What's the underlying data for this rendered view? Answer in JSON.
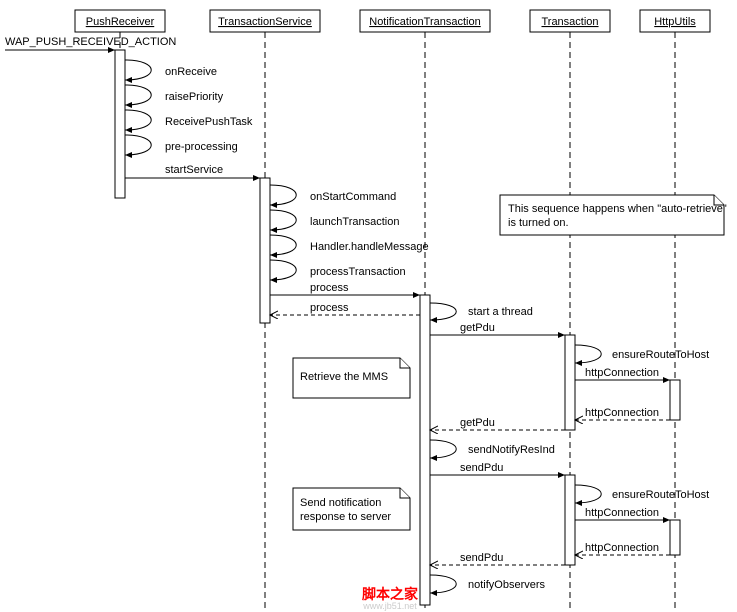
{
  "chart_data": {
    "type": "sequence-diagram",
    "lifelines": [
      "PushReceiver",
      "TransactionService",
      "NotificationTransaction",
      "Transaction",
      "HttpUtils"
    ],
    "trigger": "WAP_PUSH_RECEIVED_ACTION",
    "messages": [
      {
        "from": "PushReceiver",
        "to": "PushReceiver",
        "label": "onReceive",
        "type": "self"
      },
      {
        "from": "PushReceiver",
        "to": "PushReceiver",
        "label": "raisePriority",
        "type": "self"
      },
      {
        "from": "PushReceiver",
        "to": "PushReceiver",
        "label": "ReceivePushTask",
        "type": "self"
      },
      {
        "from": "PushReceiver",
        "to": "PushReceiver",
        "label": "pre-processing",
        "type": "self"
      },
      {
        "from": "PushReceiver",
        "to": "TransactionService",
        "label": "startService",
        "type": "call"
      },
      {
        "from": "TransactionService",
        "to": "TransactionService",
        "label": "onStartCommand",
        "type": "self"
      },
      {
        "from": "TransactionService",
        "to": "TransactionService",
        "label": "launchTransaction",
        "type": "self"
      },
      {
        "from": "TransactionService",
        "to": "TransactionService",
        "label": "Handler.handleMessage",
        "type": "self"
      },
      {
        "from": "TransactionService",
        "to": "TransactionService",
        "label": "processTransaction",
        "type": "self"
      },
      {
        "from": "TransactionService",
        "to": "NotificationTransaction",
        "label": "process",
        "type": "call"
      },
      {
        "from": "TransactionService",
        "to": "NotificationTransaction",
        "label": "process",
        "type": "return"
      },
      {
        "from": "NotificationTransaction",
        "to": "NotificationTransaction",
        "label": "start a thread",
        "type": "self"
      },
      {
        "from": "NotificationTransaction",
        "to": "Transaction",
        "label": "getPdu",
        "type": "call"
      },
      {
        "from": "Transaction",
        "to": "Transaction",
        "label": "ensureRouteToHost",
        "type": "self"
      },
      {
        "from": "Transaction",
        "to": "HttpUtils",
        "label": "httpConnection",
        "type": "call"
      },
      {
        "from": "HttpUtils",
        "to": "Transaction",
        "label": "httpConnection",
        "type": "return"
      },
      {
        "from": "Transaction",
        "to": "NotificationTransaction",
        "label": "getPdu",
        "type": "return"
      },
      {
        "from": "NotificationTransaction",
        "to": "NotificationTransaction",
        "label": "sendNotifyResInd",
        "type": "self"
      },
      {
        "from": "NotificationTransaction",
        "to": "Transaction",
        "label": "sendPdu",
        "type": "call"
      },
      {
        "from": "Transaction",
        "to": "Transaction",
        "label": "ensureRouteToHost",
        "type": "self"
      },
      {
        "from": "Transaction",
        "to": "HttpUtils",
        "label": "httpConnection",
        "type": "call"
      },
      {
        "from": "HttpUtils",
        "to": "Transaction",
        "label": "httpConnection",
        "type": "return"
      },
      {
        "from": "Transaction",
        "to": "NotificationTransaction",
        "label": "sendPdu",
        "type": "return"
      },
      {
        "from": "NotificationTransaction",
        "to": "NotificationTransaction",
        "label": "notifyObservers",
        "type": "self"
      }
    ],
    "notes": [
      {
        "text_lines": [
          "This sequence happens when \"auto-retrieve\"",
          "is turned on."
        ],
        "attached": "right-top"
      },
      {
        "text_lines": [
          "Retrieve the MMS"
        ],
        "attached": "getPdu"
      },
      {
        "text_lines": [
          "Send notification",
          "response to server"
        ],
        "attached": "sendPdu"
      }
    ]
  },
  "lifelines": {
    "l0": "PushReceiver",
    "l1": "TransactionService",
    "l2": "NotificationTransaction",
    "l3": "Transaction",
    "l4": "HttpUtils"
  },
  "trigger": "WAP_PUSH_RECEIVED_ACTION",
  "msgs": {
    "m0": "onReceive",
    "m1": "raisePriority",
    "m2": "ReceivePushTask",
    "m3": "pre-processing",
    "m4": "startService",
    "m5": "onStartCommand",
    "m6": "launchTransaction",
    "m7": "Handler.handleMessage",
    "m8": "processTransaction",
    "m9": "process",
    "m10": "process",
    "m11": "start a thread",
    "m12": "getPdu",
    "m13": "ensureRouteToHost",
    "m14": "httpConnection",
    "m15": "httpConnection",
    "m16": "getPdu",
    "m17": "sendNotifyResInd",
    "m18": "sendPdu",
    "m19": "ensureRouteToHost",
    "m20": "httpConnection",
    "m21": "httpConnection",
    "m22": "sendPdu",
    "m23": "notifyObservers"
  },
  "notes": {
    "n0a": "This sequence happens when \"auto-retrieve\"",
    "n0b": "is turned on.",
    "n1": "Retrieve the MMS",
    "n2a": "Send notification",
    "n2b": "response to server"
  },
  "watermark": {
    "red": "脚本之家",
    "gray": "www.jb51.net"
  }
}
